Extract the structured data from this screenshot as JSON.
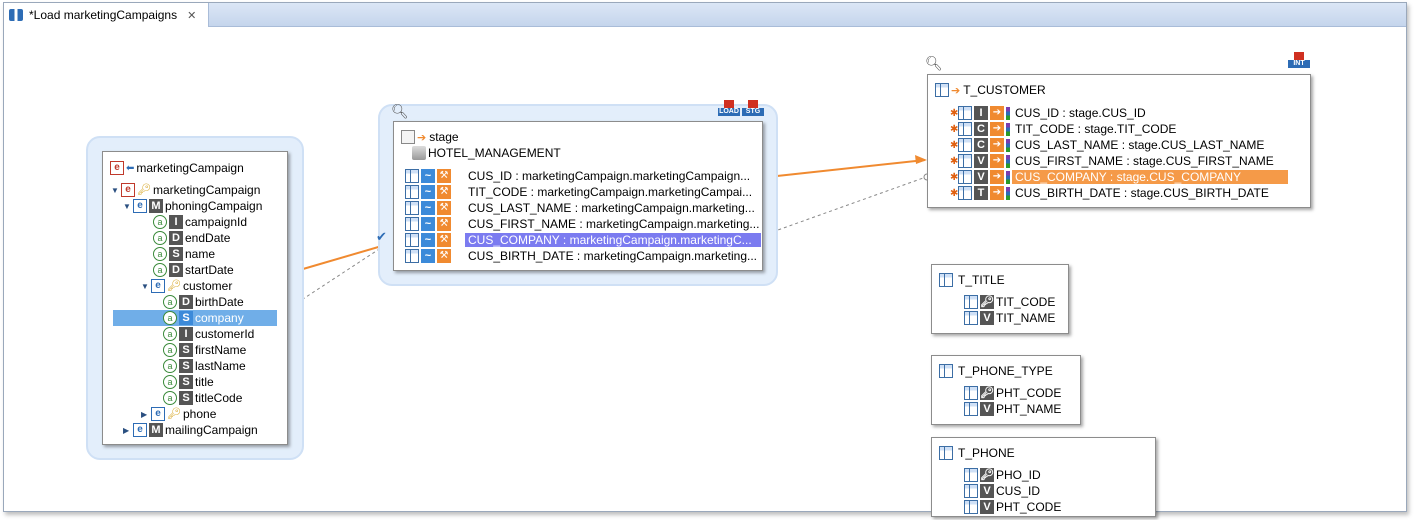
{
  "tab": {
    "title": "*Load marketingCampaigns",
    "close_icon": "close-icon"
  },
  "source": {
    "title": "marketingCampaign",
    "rows": [
      {
        "label": "marketingCampaign",
        "kind": "element",
        "expand": "open"
      },
      {
        "label": "phoningCampaign",
        "kind": "element",
        "type": "M",
        "expand": "open"
      },
      {
        "label": "campaignId",
        "kind": "attr",
        "type": "I"
      },
      {
        "label": "endDate",
        "kind": "attr",
        "type": "D"
      },
      {
        "label": "name",
        "kind": "attr",
        "type": "S"
      },
      {
        "label": "startDate",
        "kind": "attr",
        "type": "D"
      },
      {
        "label": "customer",
        "kind": "element",
        "expand": "open"
      },
      {
        "label": "birthDate",
        "kind": "attr",
        "type": "D"
      },
      {
        "label": "company",
        "kind": "attr",
        "type": "S",
        "selected": true
      },
      {
        "label": "customerId",
        "kind": "attr",
        "type": "I"
      },
      {
        "label": "firstName",
        "kind": "attr",
        "type": "S"
      },
      {
        "label": "lastName",
        "kind": "attr",
        "type": "S"
      },
      {
        "label": "title",
        "kind": "attr",
        "type": "S"
      },
      {
        "label": "titleCode",
        "kind": "attr",
        "type": "S"
      },
      {
        "label": "phone",
        "kind": "element",
        "expand": "closed"
      },
      {
        "label": "mailingCampaign",
        "kind": "element",
        "type": "M",
        "expand": "closed"
      }
    ]
  },
  "stage": {
    "title": "stage",
    "subtitle": "HOTEL_MANAGEMENT",
    "badges": [
      "LOAD",
      "STG"
    ],
    "rows": [
      "CUS_ID : marketingCampaign.marketingCampaign...",
      "TIT_CODE : marketingCampaign.marketingCampai...",
      "CUS_LAST_NAME : marketingCampaign.marketing...",
      "CUS_FIRST_NAME : marketingCampaign.marketing...",
      "CUS_COMPANY : marketingCampaign.marketingC...",
      "CUS_BIRTH_DATE : marketingCampaign.marketing..."
    ],
    "selected_index": 4
  },
  "target": {
    "title": "T_CUSTOMER",
    "badge": "INT",
    "rows": [
      {
        "text": "CUS_ID : stage.CUS_ID",
        "type": "I"
      },
      {
        "text": "TIT_CODE : stage.TIT_CODE",
        "type": "C"
      },
      {
        "text": "CUS_LAST_NAME : stage.CUS_LAST_NAME",
        "type": "C"
      },
      {
        "text": "CUS_FIRST_NAME : stage.CUS_FIRST_NAME",
        "type": "V"
      },
      {
        "text": "CUS_COMPANY : stage.CUS_COMPANY",
        "type": "V"
      },
      {
        "text": "CUS_BIRTH_DATE : stage.CUS_BIRTH_DATE",
        "type": "T"
      }
    ],
    "selected_index": 4
  },
  "tables": [
    {
      "title": "T_TITLE",
      "cols": [
        "TIT_CODE",
        "TIT_NAME"
      ]
    },
    {
      "title": "T_PHONE_TYPE",
      "cols": [
        "PHT_CODE",
        "PHT_NAME"
      ]
    },
    {
      "title": "T_PHONE",
      "cols": [
        "PHO_ID",
        "CUS_ID",
        "PHT_CODE"
      ]
    }
  ],
  "colors": {
    "accent_orange": "#f08a30",
    "accent_blue": "#3c8ad9",
    "selected_stage": "#7b7bf0"
  }
}
